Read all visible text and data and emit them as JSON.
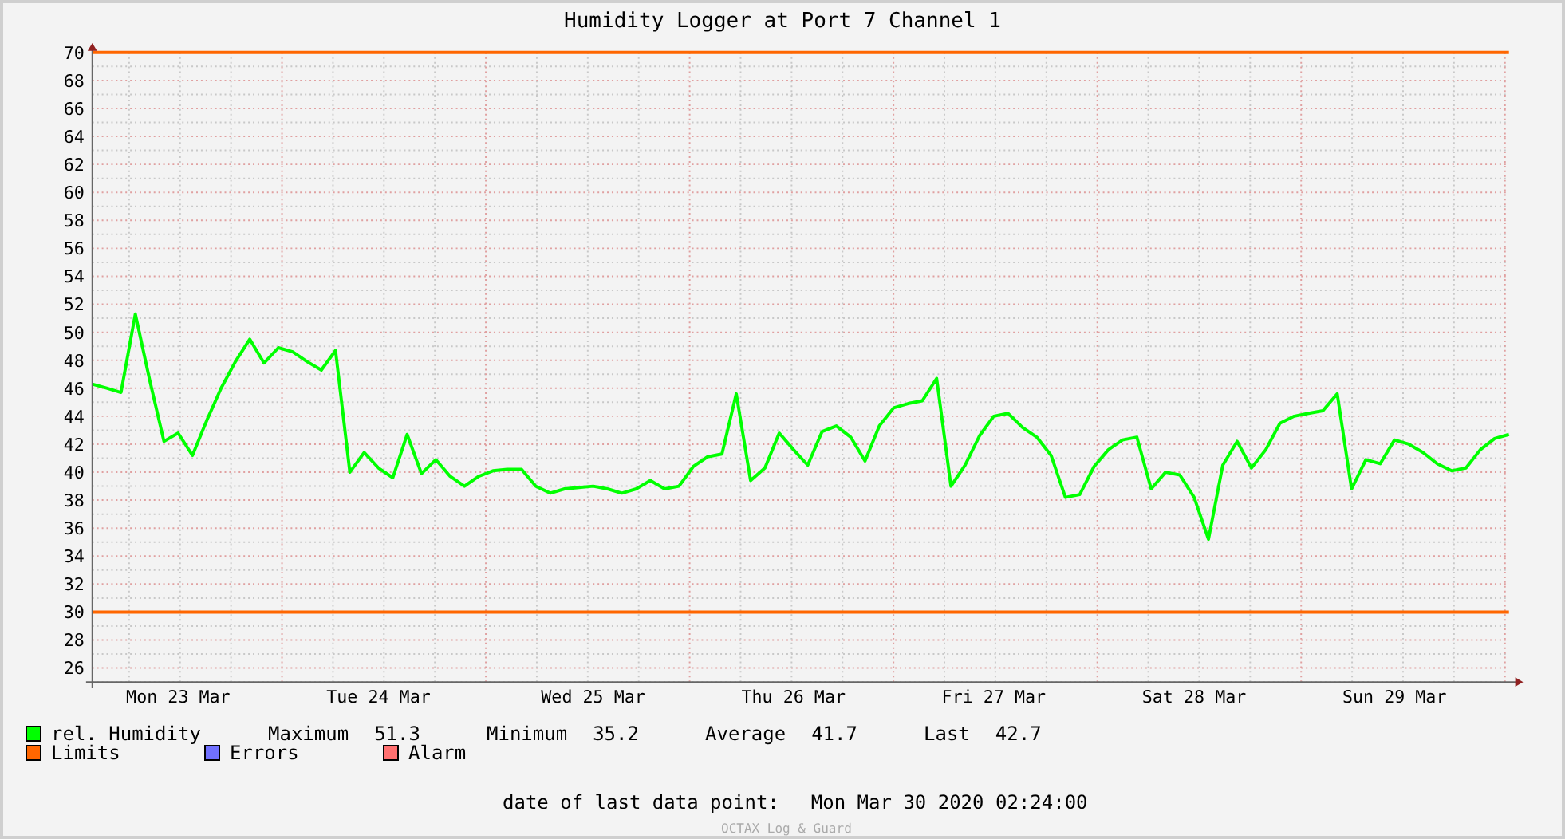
{
  "title": "Humidity Logger at Port 7 Channel 1",
  "chart": {
    "chart_data": {
      "type": "line",
      "ylim": [
        25,
        70
      ],
      "grid": true,
      "yticks": [
        26,
        28,
        30,
        32,
        34,
        36,
        38,
        40,
        42,
        44,
        46,
        48,
        50,
        52,
        54,
        56,
        58,
        60,
        62,
        64,
        66,
        68,
        70
      ],
      "categories": [
        null,
        null,
        null,
        null,
        null,
        null,
        "Mon 23 Mar",
        null,
        null,
        null,
        null,
        null,
        null,
        null,
        null,
        null,
        null,
        null,
        null,
        null,
        "Tue 24 Mar",
        null,
        null,
        null,
        null,
        null,
        null,
        null,
        null,
        null,
        null,
        null,
        null,
        null,
        null,
        "Wed 25 Mar",
        null,
        null,
        null,
        null,
        null,
        null,
        null,
        null,
        null,
        null,
        null,
        null,
        null,
        "Thu 26 Mar",
        null,
        null,
        null,
        null,
        null,
        null,
        null,
        null,
        null,
        null,
        null,
        null,
        null,
        "Fri 27 Mar",
        null,
        null,
        null,
        null,
        null,
        null,
        null,
        null,
        null,
        null,
        null,
        null,
        null,
        "Sat 28 Mar",
        null,
        null,
        null,
        null,
        null,
        null,
        null,
        null,
        null,
        null,
        null,
        null,
        null,
        "Sun 29 Mar",
        null,
        null,
        null,
        null,
        null,
        null,
        null,
        null
      ],
      "series": [
        {
          "name": "rel. Humidity",
          "color": "#00ff00",
          "values": [
            46.3,
            46.0,
            45.7,
            51.3,
            46.6,
            42.2,
            42.8,
            41.2,
            43.7,
            46.0,
            47.9,
            49.5,
            47.8,
            48.9,
            48.6,
            47.9,
            47.3,
            48.7,
            40.0,
            41.4,
            40.3,
            39.6,
            42.7,
            39.9,
            40.9,
            39.7,
            39.0,
            39.7,
            40.1,
            40.2,
            40.2,
            39.0,
            38.5,
            38.8,
            38.9,
            39.0,
            38.8,
            38.5,
            38.8,
            39.4,
            38.8,
            39.0,
            40.4,
            41.1,
            41.3,
            45.6,
            39.4,
            40.3,
            42.8,
            41.6,
            40.5,
            42.9,
            43.3,
            42.5,
            40.8,
            43.3,
            44.6,
            44.9,
            45.1,
            46.7,
            39.0,
            40.5,
            42.6,
            44.0,
            44.2,
            43.2,
            42.5,
            41.2,
            38.2,
            38.4,
            40.4,
            41.6,
            42.3,
            42.5,
            38.8,
            40.0,
            39.8,
            38.2,
            35.2,
            40.5,
            42.2,
            40.3,
            41.6,
            43.5,
            44.0,
            44.2,
            44.4,
            45.6,
            38.8,
            40.9,
            40.6,
            42.3,
            42.0,
            41.4,
            40.6,
            40.1,
            40.3,
            41.6,
            42.4,
            42.7
          ]
        },
        {
          "name": "Limits",
          "color": "#ff6600",
          "values": [
            70,
            70,
            70,
            70,
            70,
            70,
            70,
            70,
            70,
            70,
            70,
            70,
            70,
            70,
            70,
            70,
            70,
            70,
            70,
            70,
            70,
            70,
            70,
            70,
            70,
            70,
            70,
            70,
            70,
            70,
            70,
            70,
            70,
            70,
            70,
            70,
            70,
            70,
            70,
            70,
            70,
            70,
            70,
            70,
            70,
            70,
            70,
            70,
            70,
            70,
            70,
            70,
            70,
            70,
            70,
            70,
            70,
            70,
            70,
            70,
            70,
            70,
            70,
            70,
            70,
            70,
            70,
            70,
            70,
            70,
            70,
            70,
            70,
            70,
            70,
            70,
            70,
            70,
            70,
            70,
            70,
            70,
            70,
            70,
            70,
            70,
            70,
            70,
            70,
            70,
            70,
            70,
            70,
            70,
            70,
            70,
            70,
            70,
            70,
            70
          ]
        },
        {
          "color": "#ff6600",
          "values": [
            30,
            30,
            30,
            30,
            30,
            30,
            30,
            30,
            30,
            30,
            30,
            30,
            30,
            30,
            30,
            30,
            30,
            30,
            30,
            30,
            30,
            30,
            30,
            30,
            30,
            30,
            30,
            30,
            30,
            30,
            30,
            30,
            30,
            30,
            30,
            30,
            30,
            30,
            30,
            30,
            30,
            30,
            30,
            30,
            30,
            30,
            30,
            30,
            30,
            30,
            30,
            30,
            30,
            30,
            30,
            30,
            30,
            30,
            30,
            30,
            30,
            30,
            30,
            30,
            30,
            30,
            30,
            30,
            30,
            30,
            30,
            30,
            30,
            30,
            30,
            30,
            30,
            30,
            30,
            30,
            30,
            30,
            30,
            30,
            30,
            30,
            30,
            30,
            30,
            30,
            30,
            30,
            30,
            30,
            30,
            30,
            30,
            30,
            30,
            30
          ]
        }
      ]
    }
  },
  "legend": [
    {
      "label": "Errors",
      "color": "#7070ff"
    },
    {
      "label": "Alarm",
      "color": "#ff7070"
    }
  ],
  "stats": [
    {
      "label": "Maximum",
      "value": "51.3"
    },
    {
      "label": "Minimum",
      "value": "35.2"
    },
    {
      "label": "Average",
      "value": "41.7"
    },
    {
      "label": "Last",
      "value": "42.7"
    }
  ],
  "last_data_point": {
    "label": "date of last data point:",
    "value": "Mon Mar 30 2020 02:24:00"
  },
  "watermark": "OCTAX Log & Guard"
}
